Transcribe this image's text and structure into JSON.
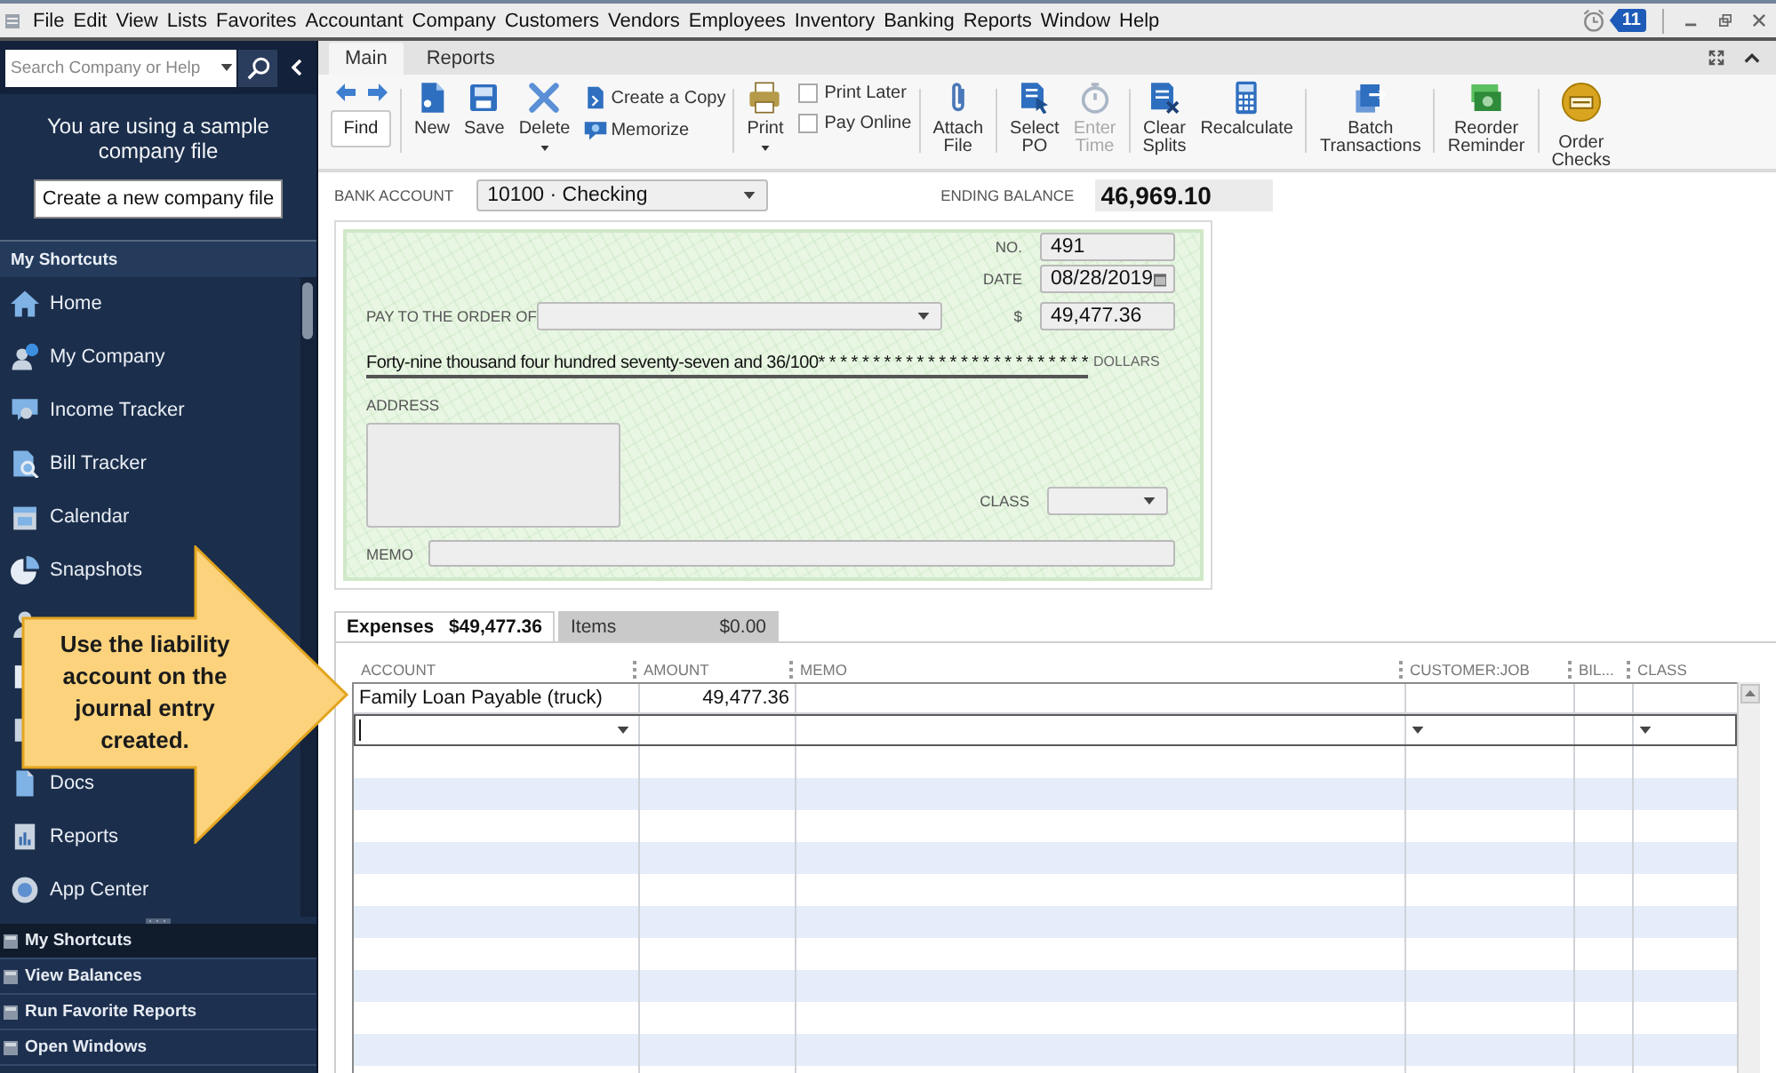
{
  "menu_bar": {
    "items": [
      "File",
      "Edit",
      "View",
      "Lists",
      "Favorites",
      "Accountant",
      "Company",
      "Customers",
      "Vendors",
      "Employees",
      "Inventory",
      "Banking",
      "Reports",
      "Window",
      "Help"
    ],
    "reminder_count": "11"
  },
  "sidebar": {
    "search": {
      "placeholder": "Search Company or Help"
    },
    "notice": "You are using a sample company file",
    "create_button": "Create a new company file",
    "shortcuts_title": "My Shortcuts",
    "shortcuts": [
      {
        "kind": "item",
        "label": "Home"
      },
      {
        "kind": "item",
        "label": "My Company"
      },
      {
        "kind": "item",
        "label": "Income Tracker"
      },
      {
        "kind": "item",
        "label": "Bill Tracker"
      },
      {
        "kind": "item",
        "label": "Calendar"
      },
      {
        "kind": "item",
        "label": "Snapshots"
      },
      {
        "kind": "covered"
      },
      {
        "kind": "covered"
      },
      {
        "kind": "covered"
      },
      {
        "kind": "item",
        "label": "Docs"
      },
      {
        "kind": "item",
        "label": "Reports"
      },
      {
        "kind": "item",
        "label": "App Center"
      }
    ],
    "panels": [
      {
        "label": "My Shortcuts",
        "selected": true
      },
      {
        "label": "View Balances",
        "selected": false
      },
      {
        "label": "Run Favorite Reports",
        "selected": false
      },
      {
        "label": "Open Windows",
        "selected": false
      }
    ]
  },
  "ribbon_tabs": [
    {
      "label": "Main",
      "selected": true
    },
    {
      "label": "Reports",
      "selected": false
    }
  ],
  "toolbar": [
    [
      {
        "kind": "find",
        "label": "Find"
      }
    ],
    [
      {
        "kind": "large",
        "label": "New",
        "dropdown": false,
        "disabled": false
      },
      {
        "kind": "large",
        "label": "Save",
        "dropdown": false,
        "disabled": false
      },
      {
        "kind": "large",
        "label": "Delete",
        "dropdown": true,
        "disabled": false
      },
      {
        "kind": "stack",
        "items": [
          {
            "label": "Create a Copy"
          },
          {
            "label": "Memorize"
          }
        ]
      }
    ],
    [
      {
        "kind": "large",
        "label": "Print",
        "dropdown": true,
        "disabled": false
      },
      {
        "kind": "checks",
        "items": [
          {
            "label": "Print Later",
            "checked": false
          },
          {
            "label": "Pay Online",
            "checked": false
          }
        ]
      }
    ],
    [
      {
        "kind": "large",
        "label": "Attach File",
        "dropdown": false,
        "disabled": false
      }
    ],
    [
      {
        "kind": "large",
        "label": "Select PO",
        "dropdown": false,
        "disabled": false
      },
      {
        "kind": "large",
        "label": "Enter Time",
        "dropdown": false,
        "disabled": true
      }
    ],
    [
      {
        "kind": "large",
        "label": "Clear Splits",
        "dropdown": false,
        "disabled": false
      },
      {
        "kind": "large",
        "label": "Recalculate",
        "dropdown": false,
        "disabled": false
      }
    ],
    [
      {
        "kind": "large",
        "label": "Batch Transactions",
        "dropdown": false,
        "disabled": false
      }
    ],
    [
      {
        "kind": "large",
        "label": "Reorder Reminder",
        "dropdown": false,
        "disabled": false
      }
    ],
    [
      {
        "kind": "large",
        "label": "Order Checks",
        "dropdown": false,
        "disabled": false
      }
    ]
  ],
  "form": {
    "bank_account": {
      "label": "BANK ACCOUNT",
      "value": "10100 · Checking"
    },
    "ending_balance": {
      "label": "ENDING BALANCE",
      "value": "46,969.10"
    }
  },
  "check": {
    "number": {
      "label": "NO.",
      "value": "491"
    },
    "date": {
      "label": "DATE",
      "value": "08/28/2019"
    },
    "payee": {
      "label": "PAY TO THE ORDER OF"
    },
    "amount": {
      "label": "$",
      "value": "49,477.36"
    },
    "amount_words": "Forty-nine thousand four hundred seventy-seven and 36/100* * * * * * * * * * * * * * * * * * * * * * * * *",
    "currency": "DOLLARS",
    "address": {
      "label": "ADDRESS"
    },
    "class": {
      "label": "CLASS"
    },
    "memo": {
      "label": "MEMO"
    }
  },
  "split_tabs": [
    {
      "label": "Expenses",
      "amount": "$49,477.36",
      "selected": true
    },
    {
      "label": "Items",
      "amount": "$0.00",
      "selected": false
    }
  ],
  "table": {
    "columns": [
      "ACCOUNT",
      "AMOUNT",
      "MEMO",
      "CUSTOMER:JOB",
      "BIL...",
      "CLASS"
    ],
    "rows": [
      {
        "account": "Family Loan Payable (truck)",
        "amount": "49,477.36"
      }
    ]
  },
  "callout": "Use the liability account on the journal entry created."
}
